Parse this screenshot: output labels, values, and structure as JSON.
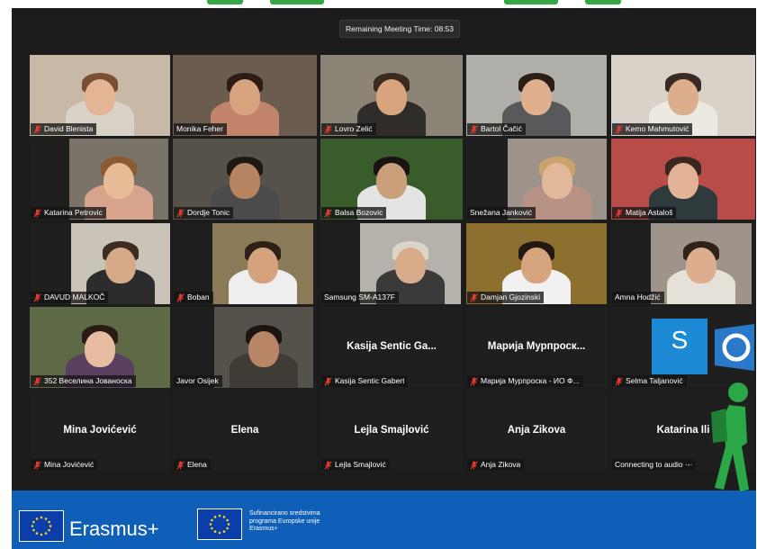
{
  "meeting": {
    "remaining_time": "Remaining Meeting Time: 08:53",
    "accent_active": "#c4e04a",
    "muted_icon": "muted-microphone-icon"
  },
  "participants": [
    {
      "name": "David Blenista",
      "muted": true
    },
    {
      "name": "Monika Feher",
      "muted": false,
      "active": true
    },
    {
      "name": "Lovro Zelić",
      "muted": true
    },
    {
      "name": "Bartol Čačić",
      "muted": true
    },
    {
      "name": "Kemo Mahmutović",
      "muted": true
    },
    {
      "name": "Katarina Petrovic",
      "muted": true
    },
    {
      "name": "Dordje Tonic",
      "muted": true
    },
    {
      "name": "Balsa Bozovic",
      "muted": true
    },
    {
      "name": "Snežana Janković",
      "muted": false
    },
    {
      "name": "Matija Astaloš",
      "muted": true
    },
    {
      "name": "DAVUD MALKOČ",
      "muted": true
    },
    {
      "name": "Boban",
      "muted": true
    },
    {
      "name": "Samsung SM-A137F",
      "muted": false
    },
    {
      "name": "Damjan Gjozinski",
      "muted": true
    },
    {
      "name": "Amna Hodžić",
      "muted": false
    },
    {
      "name": "352 Веселина Јованоска",
      "muted": true
    },
    {
      "name": "Javor Osijek",
      "muted": false
    },
    {
      "name": "Kasija Sentic Gabert",
      "display": "Kasija Sentic Ga...",
      "muted": true
    },
    {
      "name": "Марија Мурпроска - ИО Ф...",
      "display": "Марија Мурпроск...",
      "muted": true
    },
    {
      "name": "Selma Taljanović",
      "muted": true
    },
    {
      "name": "Mina Jovićević",
      "display": "Mina Jovićević",
      "muted": true
    },
    {
      "name": "Elena",
      "display": "Elena",
      "muted": true
    },
    {
      "name": "Lejla Smajlović",
      "display": "Lejla Smajlović",
      "muted": true
    },
    {
      "name": "Anja Zikova",
      "display": "Anja Zikova",
      "muted": true
    },
    {
      "name": "Connecting to audio ·‑·",
      "display": "Katarina Ili",
      "muted": false
    }
  ],
  "banner": {
    "erasmus_logo_text": "Erasmus+",
    "cofund_lines": [
      "Sufinancirano sredstvima",
      "programa Europske unije",
      "Erasmus+"
    ],
    "brand_blue": "#0f5fb8"
  },
  "side_logo": {
    "letter": "S"
  }
}
